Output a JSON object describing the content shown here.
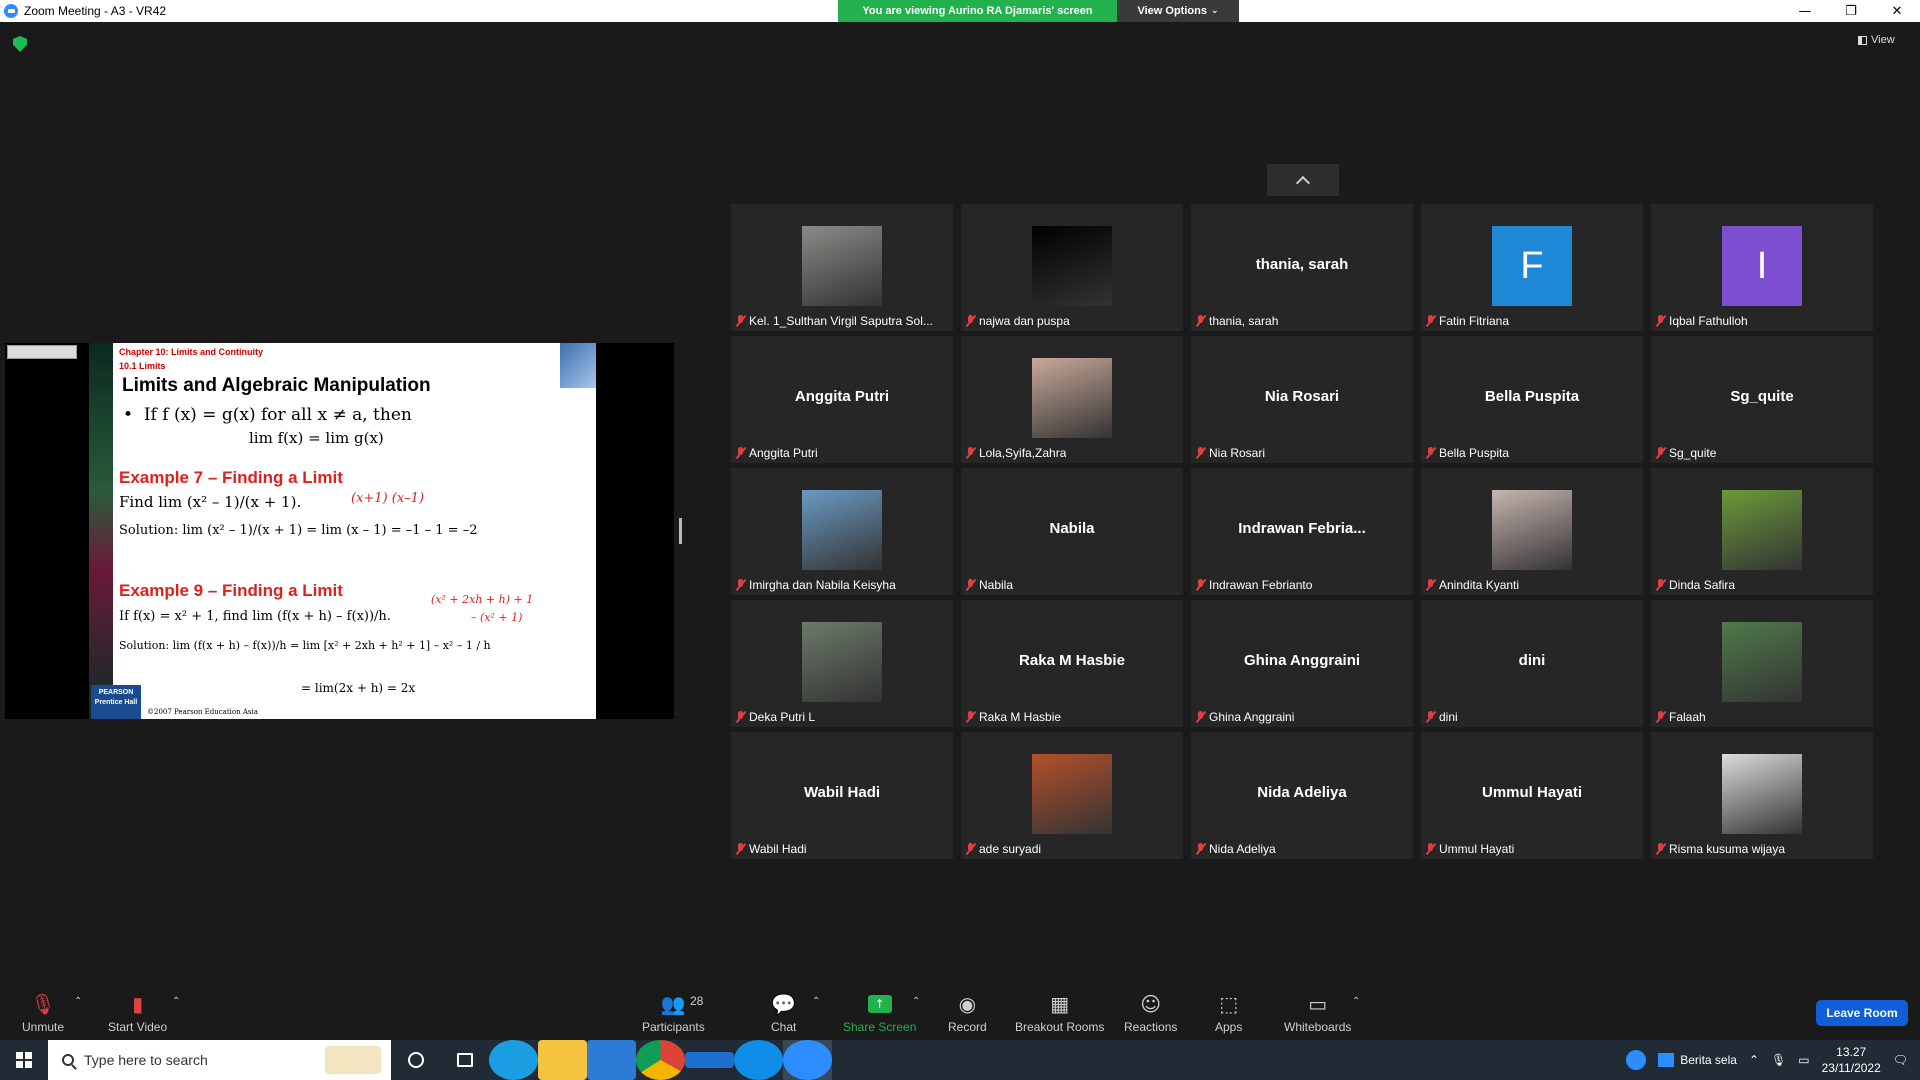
{
  "window": {
    "title": "Zoom Meeting - A3 - VR42"
  },
  "banner": {
    "viewing": "You are viewing Aurino RA Djamaris' screen",
    "view_options": "View Options"
  },
  "window_controls": {
    "minimize": "—",
    "restore": "❐",
    "close": "✕"
  },
  "view_label": "View",
  "slide": {
    "chapter": "Chapter 10: Limits and Continuity",
    "section": "10.1 Limits",
    "heading": "Limits and Algebraic Manipulation",
    "rule": "If f (x) = g(x) for all x ≠ a, then",
    "rule_formula": "lim f(x) = lim g(x)",
    "example7": "Example 7 – Finding a Limit",
    "example7_find": "Find lim (x² – 1)/(x + 1).",
    "example7_solution": "Solution: lim (x² – 1)/(x + 1) = lim (x – 1) = –1 – 1 = –2",
    "example9": "Example 9 – Finding a Limit",
    "example9_if": "If f(x) = x² + 1, find lim (f(x + h) – f(x))/h.",
    "example9_solution": "Solution: lim (f(x + h) – f(x))/h = lim [x² + 2xh + h² + 1] – x² – 1 / h",
    "example9_result": "= lim(2x + h) = 2x",
    "handwritten_a": "(x+1) (x–1)",
    "handwritten_b": "(x² + 2xh + h) + 1",
    "handwritten_c": "– (x² + 1)",
    "publisher": "PEARSON",
    "imprint": "Prentice Hall",
    "copyright": "©2007 Pearson Education Asia"
  },
  "participants_tiles": [
    {
      "display": "photo",
      "label": "Kel. 1_Sulthan Virgil Saputra Sol...",
      "color": "#8a8a86"
    },
    {
      "display": "photo",
      "label": "najwa dan puspa",
      "color": "#000000"
    },
    {
      "display": "name",
      "big": "thania, sarah",
      "label": "thania, sarah"
    },
    {
      "display": "letter",
      "letter": "F",
      "label": "Fatin Fitriana",
      "color": "#1e88d6"
    },
    {
      "display": "letter",
      "letter": "I",
      "label": "Iqbal Fathulloh",
      "color": "#7c4fd0"
    },
    {
      "display": "name",
      "big": "Anggita Putri",
      "label": "Anggita Putri"
    },
    {
      "display": "photo",
      "label": "Lola,Syifa,Zahra",
      "color": "#c9a99a"
    },
    {
      "display": "name",
      "big": "Nia Rosari",
      "label": "Nia Rosari"
    },
    {
      "display": "name",
      "big": "Bella  Puspita",
      "label": "Bella  Puspita"
    },
    {
      "display": "name",
      "big": "Sg_quite",
      "label": "Sg_quite"
    },
    {
      "display": "photo",
      "label": "Imirgha dan Nabila Keisyha",
      "color": "#6a9ac4"
    },
    {
      "display": "name",
      "big": "Nabila",
      "label": "Nabila"
    },
    {
      "display": "name",
      "big": "Indrawan  Febria...",
      "label": "Indrawan Febrianto"
    },
    {
      "display": "photo",
      "label": "Anindita Kyanti",
      "color": "#c7b5b0"
    },
    {
      "display": "photo",
      "label": "Dinda Safira",
      "color": "#6b9a3a"
    },
    {
      "display": "photo",
      "label": "Deka Putri L",
      "color": "#6c7a6a"
    },
    {
      "display": "name",
      "big": "Raka M Hasbie",
      "label": "Raka M Hasbie"
    },
    {
      "display": "name",
      "big": "Ghina Anggraini",
      "label": "Ghina Anggraini"
    },
    {
      "display": "name",
      "big": "dini",
      "label": "dini"
    },
    {
      "display": "photo",
      "label": "Falaah",
      "color": "#4f7a4a"
    },
    {
      "display": "name",
      "big": "Wabil Hadi",
      "label": "Wabil Hadi"
    },
    {
      "display": "photo",
      "label": "ade suryadi",
      "color": "#b4502a"
    },
    {
      "display": "name",
      "big": "Nida Adeliya",
      "label": "Nida Adeliya"
    },
    {
      "display": "name",
      "big": "Ummul Hayati",
      "label": "Ummul Hayati"
    },
    {
      "display": "photo",
      "label": "Risma kusuma wijaya",
      "color": "#dcdcdc"
    }
  ],
  "toolbar": {
    "unmute": "Unmute",
    "start_video": "Start Video",
    "participants": "Participants",
    "participants_count": "28",
    "chat": "Chat",
    "share_screen": "Share Screen",
    "record": "Record",
    "breakout_rooms": "Breakout Rooms",
    "reactions": "Reactions",
    "apps": "Apps",
    "whiteboards": "Whiteboards",
    "leave_room": "Leave Room"
  },
  "taskbar": {
    "search_placeholder": "Type here to search",
    "news": "Berita sela",
    "time": "13.27",
    "date": "23/11/2022"
  }
}
